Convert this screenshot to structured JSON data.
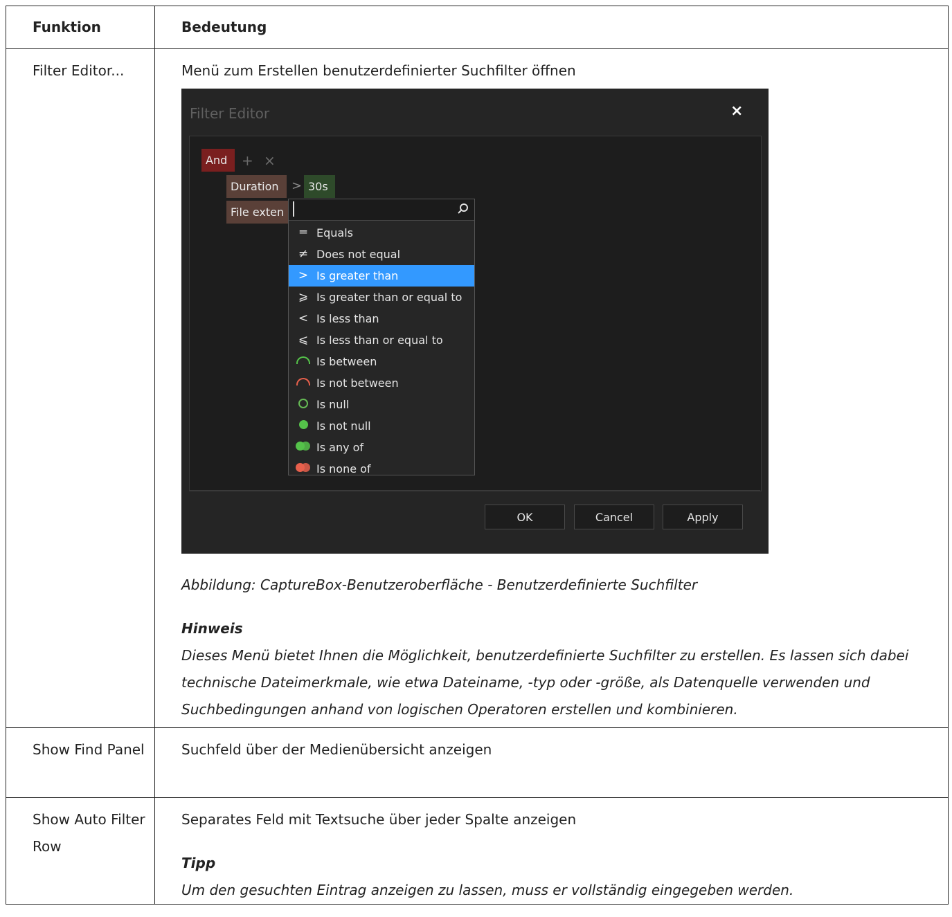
{
  "table": {
    "headers": [
      "Funktion",
      "Bedeutung"
    ],
    "rows": [
      {
        "function": "Filter Editor...",
        "description": "Menü zum Erstellen benutzerdefinierter Suchfilter öffnen",
        "caption": "Abbildung: CaptureBox-Benutzeroberfläche - Benutzerdefinierte Suchfilter",
        "note_title": "Hinweis",
        "note_text": "Dieses Menü bietet Ihnen die Möglichkeit, benutzerdefinierte Suchfilter zu erstellen. Es lassen sich dabei technische Dateimerkmale, wie etwa Dateiname, -typ oder -größe, als Datenquelle verwenden und Suchbedingungen anhand von logischen Operatoren erstellen und kombinieren."
      },
      {
        "function": "Show Find Panel",
        "description": "Suchfeld über der Medienübersicht anzeigen"
      },
      {
        "function": "Show Auto Filter Row",
        "description": "Separates Feld mit Textsuche über jeder Spalte anzeigen",
        "tip_title": "Tipp",
        "tip_text": "Um den gesuchten Eintrag anzeigen zu lassen, muss er vollständig eingegeben werden."
      }
    ]
  },
  "dialog": {
    "title": "Filter Editor",
    "close_glyph": "×",
    "group_op": "And",
    "add_glyph": "+",
    "remove_glyph": "×",
    "condition1": {
      "field": "Duration",
      "operator": ">",
      "value": "30s"
    },
    "condition2": {
      "field": "File exten"
    },
    "operators": [
      {
        "icon": "═",
        "label": "Equals"
      },
      {
        "icon": "≠",
        "label": "Does not equal"
      },
      {
        "icon": ">",
        "label": "Is greater than",
        "selected": true
      },
      {
        "icon": "⩾",
        "label": "Is greater than or equal to"
      },
      {
        "icon": "<",
        "label": "Is less than"
      },
      {
        "icon": "⩽",
        "label": "Is less than or equal to"
      },
      {
        "icon": "arc-green",
        "label": "Is between"
      },
      {
        "icon": "arc-red",
        "label": "Is not between"
      },
      {
        "icon": "circle-hollow",
        "label": "Is null"
      },
      {
        "icon": "circle-filled",
        "label": "Is not null"
      },
      {
        "icon": "dots-green",
        "label": "Is any of"
      },
      {
        "icon": "dots-red",
        "label": "Is none of"
      }
    ],
    "buttons": {
      "ok": "OK",
      "cancel": "Cancel",
      "apply": "Apply"
    },
    "colors": {
      "selected": "#3399ff",
      "and_chip": "#7a1f1f",
      "green": "#55c24a",
      "red": "#e8604c"
    }
  }
}
